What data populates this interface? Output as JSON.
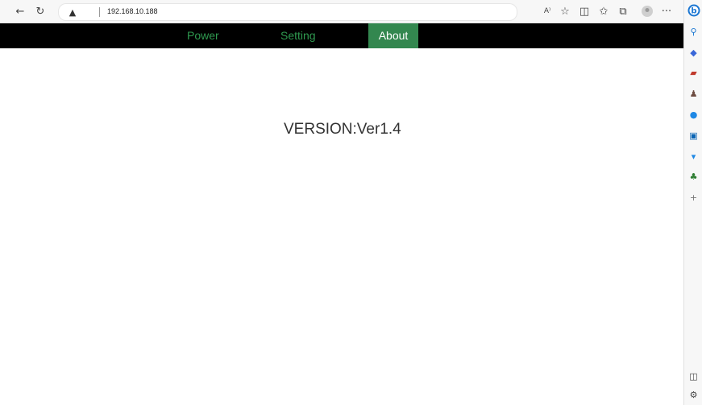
{
  "browser": {
    "url": "192.168.10.188",
    "icons": {
      "back": "back-arrow-icon",
      "refresh": "refresh-icon",
      "warning": "warning-icon",
      "read_aloud": "read-aloud-icon",
      "favorite": "favorite-star-icon",
      "split": "split-screen-icon",
      "favorites": "favorites-icon",
      "collections": "collections-icon",
      "profile": "profile-icon",
      "more": "more-icon",
      "copilot": "copilot-icon"
    }
  },
  "nav": {
    "items": [
      {
        "label": "Power"
      },
      {
        "label": "Setting"
      },
      {
        "label": "About",
        "active": true
      }
    ],
    "colors": {
      "bar": "#000000",
      "link": "#2f9a50",
      "active_bg": "#33874f"
    }
  },
  "main": {
    "version_text": "VERSION:Ver1.4"
  }
}
